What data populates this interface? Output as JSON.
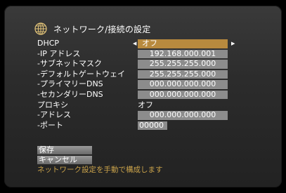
{
  "header": {
    "title": "ネットワーク/接続の設定",
    "icon": "globe-icon"
  },
  "settings": [
    {
      "label": "DHCP",
      "value": "オフ"
    },
    {
      "label": "-IP アドレス",
      "value": "192.168.000.001"
    },
    {
      "label": "-サブネットマスク",
      "value": "255.255.255.000"
    },
    {
      "label": "-デフォルトゲートウェイ",
      "value": "255.255.255.000"
    },
    {
      "label": "-プライマリーDNS",
      "value": "000.000.000.000"
    },
    {
      "label": "-セカンダリーDNS",
      "value": "000.000.000.000"
    },
    {
      "label": "プロキシ",
      "value": "オフ"
    },
    {
      "label": "-アドレス",
      "value": "000.000.000.000"
    },
    {
      "label": "-ポート",
      "value": "00000"
    }
  ],
  "buttons": {
    "save": "保存",
    "cancel": "キャンセル"
  },
  "hint": "ネットワーク設定を手動で構成します",
  "colors": {
    "selected": "#b88a3e",
    "field": "#8c8c8c",
    "hint": "#c9a24a"
  }
}
